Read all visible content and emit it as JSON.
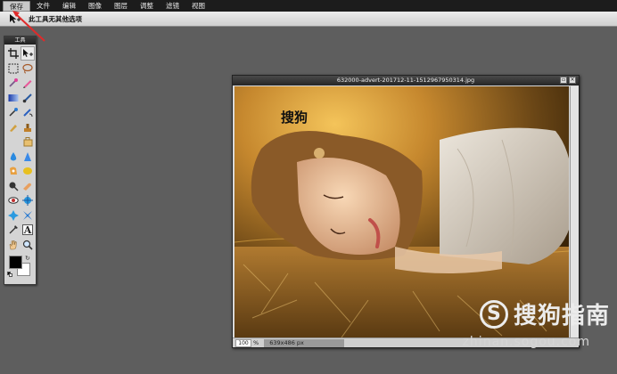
{
  "menubar": {
    "items": [
      "保存",
      "文件",
      "编辑",
      "图像",
      "图层",
      "调整",
      "滤镜",
      "视图"
    ]
  },
  "options": {
    "tool_icon": "move-tool-icon",
    "message": "此工具无其他选项"
  },
  "tools": {
    "title": "工具",
    "items": [
      "crop-icon",
      "move-icon",
      "marquee-icon",
      "lasso-icon",
      "magic-wand-icon",
      "pencil-icon",
      "gradient-icon",
      "brush-icon",
      "clone-stamp-icon",
      "color-replace-icon",
      "eraser-icon",
      "stamp-icon",
      "spacer",
      "sharpen-icon",
      "blur-icon",
      "smudge-icon",
      "red-eye-icon",
      "sponge-icon",
      "burn-icon",
      "dodge-icon",
      "eye-icon",
      "bloat-icon",
      "pinch-icon",
      "pinch-alt-icon",
      "eyedropper-icon",
      "text-icon",
      "hand-icon",
      "zoom-icon"
    ],
    "text_tool_glyph": "A",
    "foreground_color": "#000000",
    "background_color": "#ffffff"
  },
  "image_window": {
    "title": "632000-advert-201712-11-1512967950314.jpg",
    "overlay_text": "搜狗",
    "zoom_value": "100",
    "zoom_unit": "%",
    "dimensions": "639x486 px"
  },
  "watermark": {
    "logo_letter": "S",
    "brand": "搜狗指南",
    "url": "zhinan.sogou.com"
  },
  "colors": {
    "canvas_bg": "#5e5e5e",
    "menubar_bg": "#1c1c1c",
    "annotation_arrow": "#e02a2a"
  }
}
